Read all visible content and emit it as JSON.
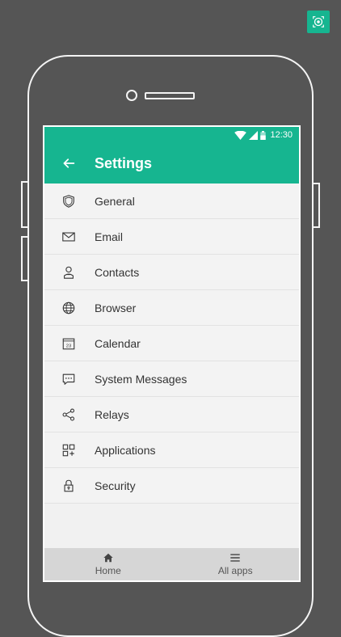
{
  "status": {
    "time": "12:30"
  },
  "app_bar": {
    "title": "Settings"
  },
  "menu": [
    {
      "label": "General",
      "icon": "shield-icon"
    },
    {
      "label": "Email",
      "icon": "envelope-icon"
    },
    {
      "label": "Contacts",
      "icon": "contact-icon"
    },
    {
      "label": "Browser",
      "icon": "globe-icon"
    },
    {
      "label": "Calendar",
      "icon": "calendar-icon"
    },
    {
      "label": "System Messages",
      "icon": "chat-bubble-icon"
    },
    {
      "label": "Relays",
      "icon": "share-nodes-icon"
    },
    {
      "label": "Applications",
      "icon": "apps-grid-icon"
    },
    {
      "label": "Security",
      "icon": "lock-icon"
    }
  ],
  "calendar_icon_day": "23",
  "bottom_nav": {
    "home_label": "Home",
    "all_apps_label": "All apps"
  },
  "colors": {
    "accent": "#16b590",
    "background": "#555555"
  }
}
